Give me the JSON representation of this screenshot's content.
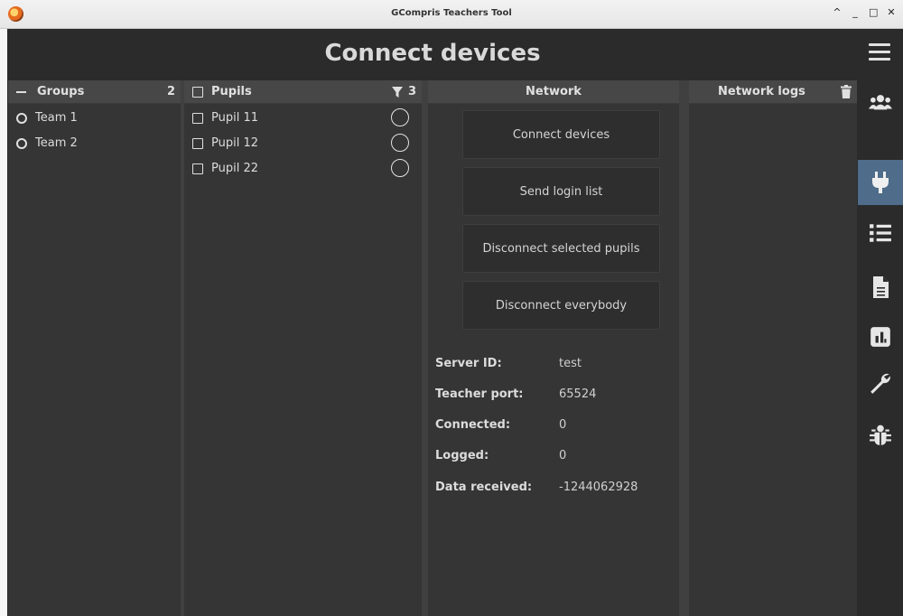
{
  "window": {
    "title": "GCompris Teachers Tool",
    "controls": [
      "^",
      "_",
      "□",
      "✕"
    ]
  },
  "header": {
    "title": "Connect devices"
  },
  "groups_panel": {
    "title": "Groups",
    "count": "2",
    "items": [
      {
        "label": "Team 1"
      },
      {
        "label": "Team 2"
      }
    ]
  },
  "pupils_panel": {
    "title": "Pupils",
    "count": "3",
    "items": [
      {
        "label": "Pupil 11"
      },
      {
        "label": "Pupil 12"
      },
      {
        "label": "Pupil 22"
      }
    ]
  },
  "network_panel": {
    "title": "Network",
    "buttons": {
      "connect": "Connect devices",
      "send_login": "Send login list",
      "disconnect_selected": "Disconnect selected pupils",
      "disconnect_all": "Disconnect everybody"
    },
    "info": {
      "server_id_label": "Server ID:",
      "server_id": "test",
      "teacher_port_label": "Teacher port:",
      "teacher_port": "65524",
      "connected_label": "Connected:",
      "connected": "0",
      "logged_label": "Logged:",
      "logged": "0",
      "data_received_label": "Data received:",
      "data_received": "-1244062928"
    }
  },
  "logs_panel": {
    "title": "Network logs"
  },
  "sidenav": {
    "items": [
      "users-icon",
      "plug-icon",
      "list-icon",
      "document-icon",
      "chart-icon",
      "wrench-icon",
      "bug-icon"
    ],
    "active": "plug-icon",
    "active_color": "#4f6d8a"
  },
  "colors": {
    "background": "#2b2b2b",
    "panel": "#353535",
    "panel_header": "#474747",
    "text": "#d6d6d6"
  }
}
